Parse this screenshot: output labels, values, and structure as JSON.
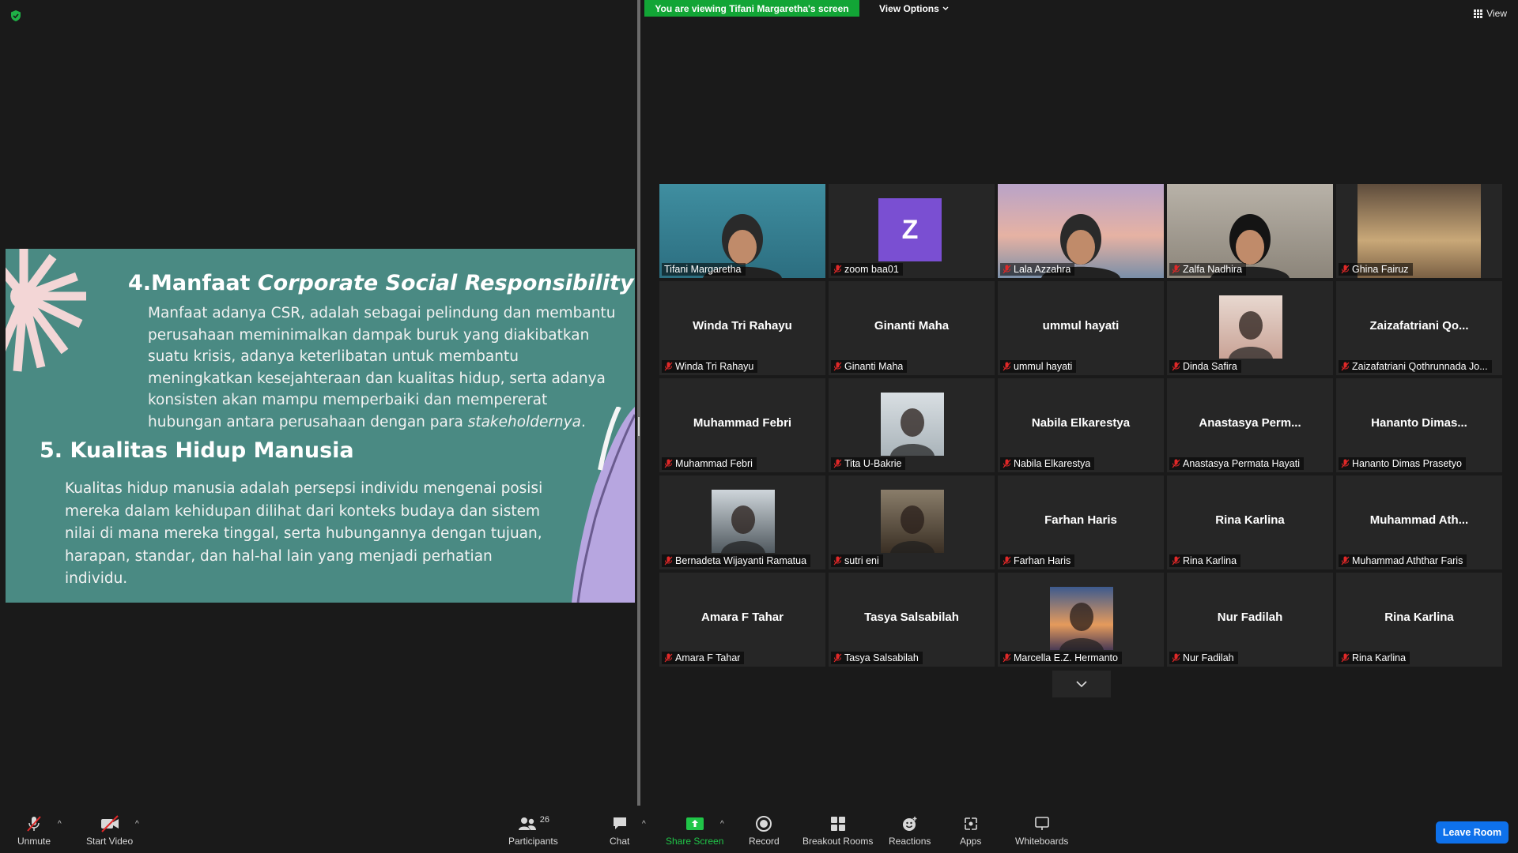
{
  "banner": {
    "viewing_text": "You are viewing Tifani Margaretha's screen",
    "view_options_label": "View Options",
    "view_label": "View"
  },
  "slide": {
    "h4_prefix": "4.Manfaat ",
    "h4_italic": "Corporate Social Responsibility",
    "p1": "Manfaat adanya CSR, adalah sebagai pelindung dan membantu perusahaan meminimalkan dampak buruk yang diakibatkan suatu krisis, adanya keterlibatan untuk membantu meningkatkan kesejahteraan dan kualitas hidup, serta adanya konsisten akan mampu memperbaiki dan mempererat hubungan antara perusahaan dengan para ",
    "p1_italic": "stakeholdernya",
    "p1_end": ".",
    "h5": "5. Kualitas Hidup Manusia",
    "p2": "Kualitas hidup manusia adalah persepsi individu mengenai posisi mereka dalam kehidupan dilihat dari konteks budaya dan sistem nilai di mana mereka tinggal, serta hubungannya dengan tujuan, harapan, standar, dan hal-hal lain yang menjadi perhatian individu."
  },
  "participants": [
    {
      "center": "",
      "name": "Tifani Margaretha",
      "muted": false,
      "kind": "video"
    },
    {
      "center": "",
      "name": "zoom baa01",
      "muted": true,
      "kind": "avatar",
      "initial": "Z"
    },
    {
      "center": "",
      "name": "Lala Azzahra",
      "muted": true,
      "kind": "video"
    },
    {
      "center": "",
      "name": "Zalfa Nadhira",
      "muted": true,
      "kind": "video"
    },
    {
      "center": "",
      "name": "Ghina Fairuz",
      "muted": true,
      "kind": "video"
    },
    {
      "center": "Winda Tri Rahayu",
      "name": "Winda Tri Rahayu",
      "muted": true,
      "kind": "text"
    },
    {
      "center": "Ginanti Maha",
      "name": "Ginanti Maha",
      "muted": true,
      "kind": "text"
    },
    {
      "center": "ummul hayati",
      "name": "ummul hayati",
      "muted": true,
      "kind": "text"
    },
    {
      "center": "",
      "name": "Dinda Safira",
      "muted": true,
      "kind": "photo"
    },
    {
      "center": "Zaizafatriani  Qo...",
      "name": "Zaizafatriani Qothrunnada Jo...",
      "muted": true,
      "kind": "text"
    },
    {
      "center": "Muhammad Febri",
      "name": "Muhammad Febri",
      "muted": true,
      "kind": "text"
    },
    {
      "center": "",
      "name": "Tita U-Bakrie",
      "muted": true,
      "kind": "photo"
    },
    {
      "center": "Nabila Elkarestya",
      "name": "Nabila Elkarestya",
      "muted": true,
      "kind": "text"
    },
    {
      "center": "Anastasya  Perm...",
      "name": "Anastasya Permata Hayati",
      "muted": true,
      "kind": "text"
    },
    {
      "center": "Hananto  Dimas...",
      "name": "Hananto Dimas Prasetyo",
      "muted": true,
      "kind": "text"
    },
    {
      "center": "",
      "name": "Bernadeta Wijayanti Ramatua",
      "muted": true,
      "kind": "photo"
    },
    {
      "center": "",
      "name": "sutri eni",
      "muted": true,
      "kind": "photo"
    },
    {
      "center": "Farhan Haris",
      "name": "Farhan Haris",
      "muted": true,
      "kind": "text"
    },
    {
      "center": "Rina Karlina",
      "name": "Rina Karlina",
      "muted": true,
      "kind": "text"
    },
    {
      "center": "Muhammad  Ath...",
      "name": "Muhammad Aththar Faris",
      "muted": true,
      "kind": "text"
    },
    {
      "center": "Amara F Tahar",
      "name": "Amara F Tahar",
      "muted": true,
      "kind": "text"
    },
    {
      "center": "Tasya Salsabilah",
      "name": "Tasya Salsabilah",
      "muted": true,
      "kind": "text"
    },
    {
      "center": "",
      "name": "Marcella E.Z. Hermanto",
      "muted": true,
      "kind": "photo"
    },
    {
      "center": "Nur Fadilah",
      "name": "Nur Fadilah",
      "muted": true,
      "kind": "text"
    },
    {
      "center": "Rina Karlina",
      "name": "Rina Karlina",
      "muted": true,
      "kind": "text"
    }
  ],
  "toolbar": {
    "unmute": "Unmute",
    "start_video": "Start Video",
    "participants": "Participants",
    "participants_count": "26",
    "chat": "Chat",
    "share_screen": "Share Screen",
    "record": "Record",
    "breakout_rooms": "Breakout Rooms",
    "reactions": "Reactions",
    "apps": "Apps",
    "whiteboards": "Whiteboards",
    "leave_room": "Leave Room"
  },
  "colors": {
    "share_green": "#12a536",
    "leave_blue": "#0e71eb",
    "slide_teal": "#4a8a83",
    "active_speaker": "#e6e6a0"
  }
}
